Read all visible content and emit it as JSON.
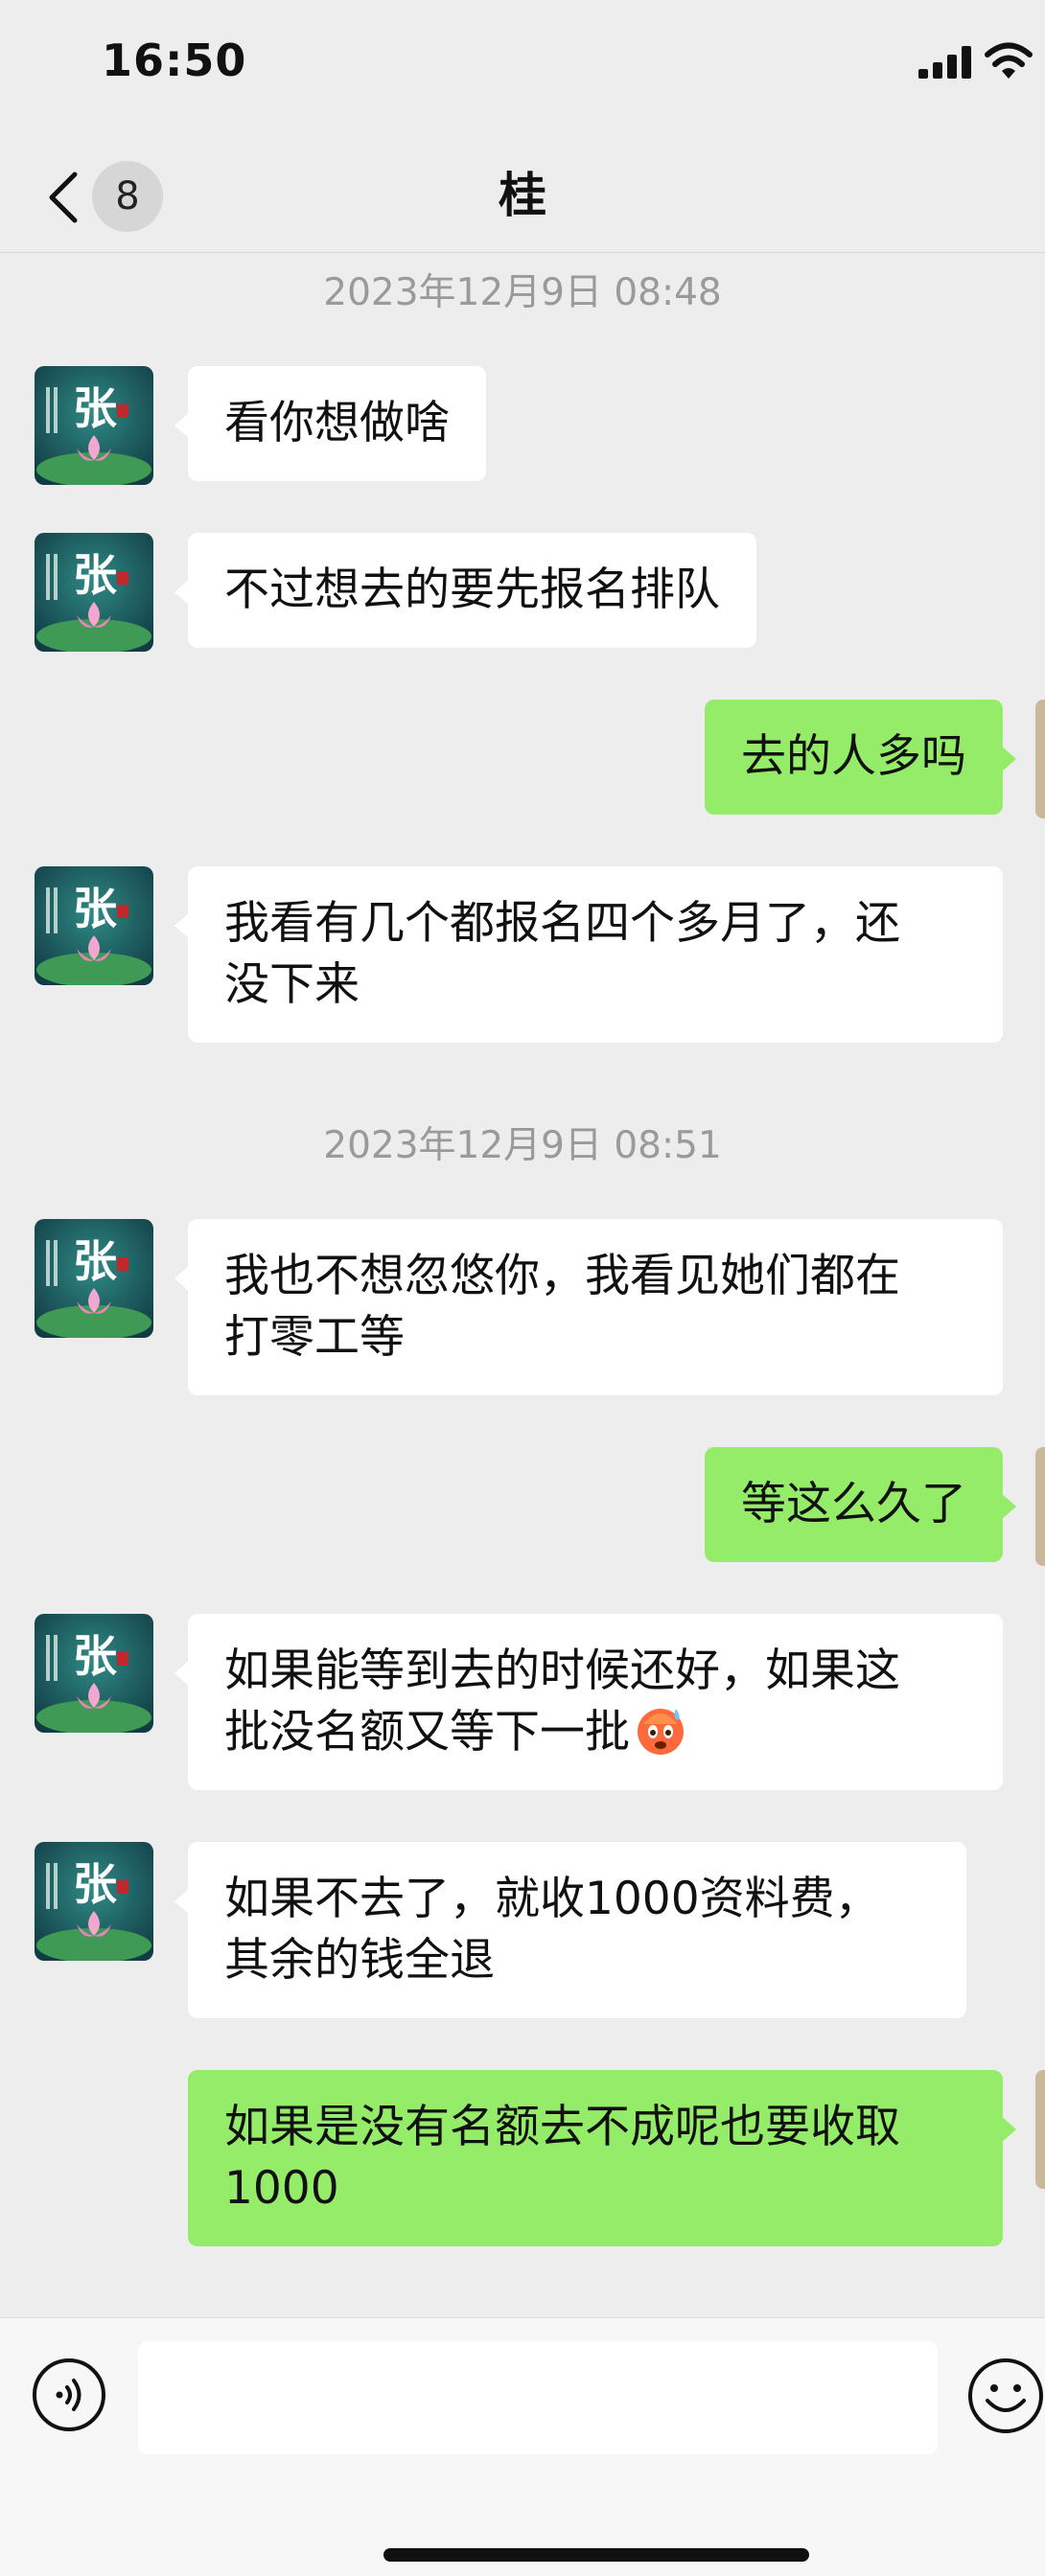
{
  "status_bar": {
    "time": "16:50"
  },
  "nav": {
    "badge_count": "8",
    "title": "桂"
  },
  "messages": {
    "ts1": "2023年12月9日 08:48",
    "m1": "看你想做啥",
    "m2": "不过想去的要先报名排队",
    "m3": "去的人多吗",
    "m4": "我看有几个都报名四个多月了，还\n没下来",
    "ts2": "2023年12月9日 08:51",
    "m5": "我也不想忽悠你，我看见她们都在\n打零工等",
    "m6": "等这么久了",
    "m7": "如果能等到去的时候还好，如果这\n批没名额又等下一批",
    "m8": "如果不去了，就收1000资料费，\n其余的钱全退",
    "m9": "如果是没有名额去不成呢也要收取\n1000"
  },
  "avatar": {
    "char": "张"
  },
  "colors": {
    "background": "#ededed",
    "incoming_bubble": "#ffffff",
    "outgoing_bubble": "#95ec69",
    "timestamp": "#9a9a9a"
  },
  "input": {
    "value": ""
  }
}
